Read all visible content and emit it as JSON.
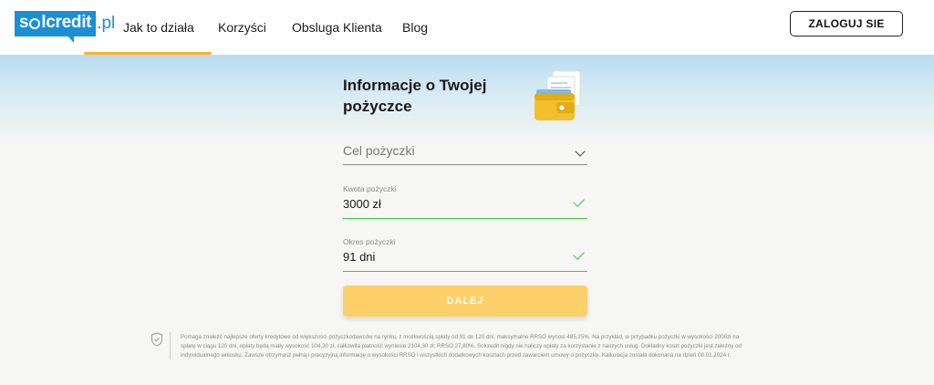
{
  "header": {
    "logo": {
      "text_before": "s",
      "text_after": "lcredit",
      "ext": ".pl"
    },
    "nav": [
      {
        "label": "Jak to działa",
        "active": true
      },
      {
        "label": "Korzyści"
      },
      {
        "label": "Obsluga Klienta"
      },
      {
        "label": "Blog"
      }
    ],
    "login_label": "ZALOGUJ SIE"
  },
  "form": {
    "title": "Informacje o Twojej pożyczce",
    "purpose_placeholder": "Cel pożyczki",
    "amount": {
      "label": "Kwota pożyczki",
      "value": "3000 zł"
    },
    "period": {
      "label": "Okres pożyczki",
      "value": "91 dni"
    },
    "submit_label": "DALEJ"
  },
  "disclaimer": {
    "lines": [
      "Pomaga znaleźć najlepsze oferty kredytowe od większości pożyczkodawców na rynku, z możliwością spłaty od 91 do 120 dni, maksymalne RRSO wynosi 485,25%. Na przykład, w przypadku pożyczki w wysokości 2000zł na",
      "spłatę w ciągu 120 dni, opłaty będą miały wysokość 104,30 zł, całkowita płatność wyniesie 2104,30 zł; RRSO 27,80%. Solcredit nigdy nie naliczy opłaty za korzystanie z naszych usług. Dokładny koszt pożyczki jest zależny od",
      "indywidualnego wniosku. Zawsze otrzymasz pełną i precyzyjną informację o wysokości RRSO i wszystkich dodatkowych kosztach przed zawarciem umowy o pożyczkę. Kalkulacja została dokonana na dzień 08.01.2024 r."
    ]
  },
  "colors": {
    "brand": "#1a8fd6",
    "accent": "#f6b52c",
    "button": "#fed069",
    "valid": "#3fc24a"
  }
}
